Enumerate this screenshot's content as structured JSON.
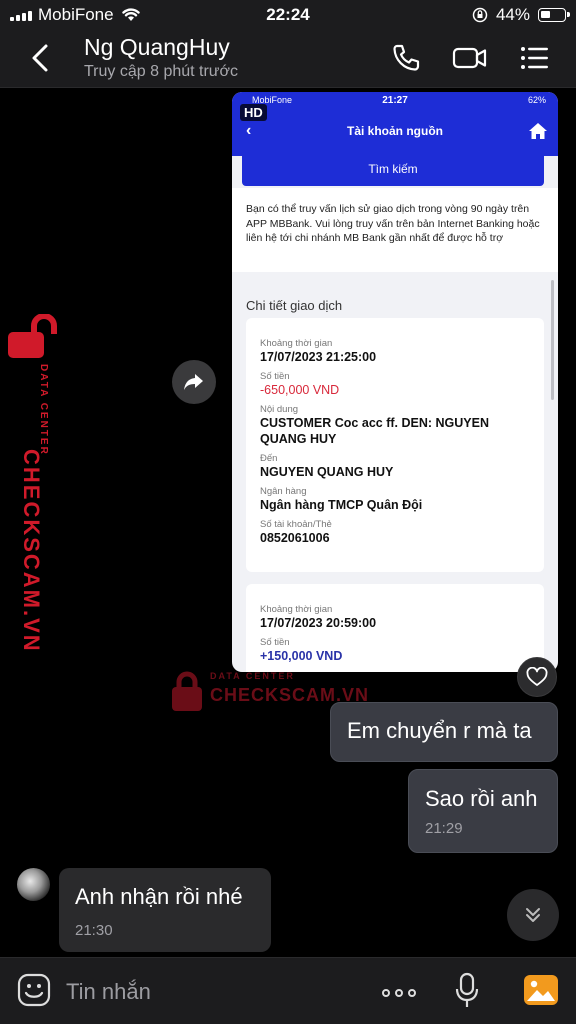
{
  "status_bar": {
    "carrier": "MobiFone",
    "time": "22:24",
    "battery_pct": "44%",
    "battery_level": 0.44
  },
  "header": {
    "name": "Ng QuangHuy",
    "status": "Truy cập 8 phút trước"
  },
  "watermark": {
    "brand": "CHECKSCAM.VN",
    "sub": "DATA CENTER"
  },
  "screenshot": {
    "hd_badge": "HD",
    "status": {
      "carrier": "MobiFone",
      "time": "21:27",
      "battery": "62%"
    },
    "title": "Tài khoản nguồn",
    "search_button": "Tìm kiếm",
    "note": "Bạn có thể truy vấn lịch sử giao dịch trong vòng 90 ngày trên APP MBBank. Vui lòng truy vấn trên bản Internet Banking hoặc liên hệ tới chi nhánh MB Bank gần nhất để được hỗ trợ",
    "section_title": "Chi tiết giao dịch",
    "transactions": [
      {
        "time_label": "Khoảng thời gian",
        "time": "17/07/2023 21:25:00",
        "amount_label": "Số tiền",
        "amount": "-650,000 VND",
        "content_label": "Nội dung",
        "content": "CUSTOMER Coc acc ff. DEN: NGUYEN QUANG HUY",
        "to_label": "Đến",
        "to": "NGUYEN QUANG HUY",
        "bank_label": "Ngân hàng",
        "bank": "Ngân hàng TMCP Quân Đội",
        "account_label": "Số tài khoản/Thẻ",
        "account": "0852061006"
      },
      {
        "time_label": "Khoảng thời gian",
        "time": "17/07/2023 20:59:00",
        "amount_label": "Số tiền",
        "amount": "+150,000 VND"
      }
    ]
  },
  "messages": [
    {
      "text": "Em chuyển r mà ta",
      "time": ""
    },
    {
      "text": "Sao rồi anh",
      "time": "21:29"
    },
    {
      "text": "Anh nhận rồi nhé",
      "time": "21:30"
    }
  ],
  "composer": {
    "placeholder": "Tin nhắn"
  },
  "colors": {
    "bank_blue": "#1e2dd6",
    "negative": "#d8283a",
    "positive": "#2a33a8",
    "watermark_red": "#d01a2a",
    "image_icon_orange": "#f29a1e"
  }
}
